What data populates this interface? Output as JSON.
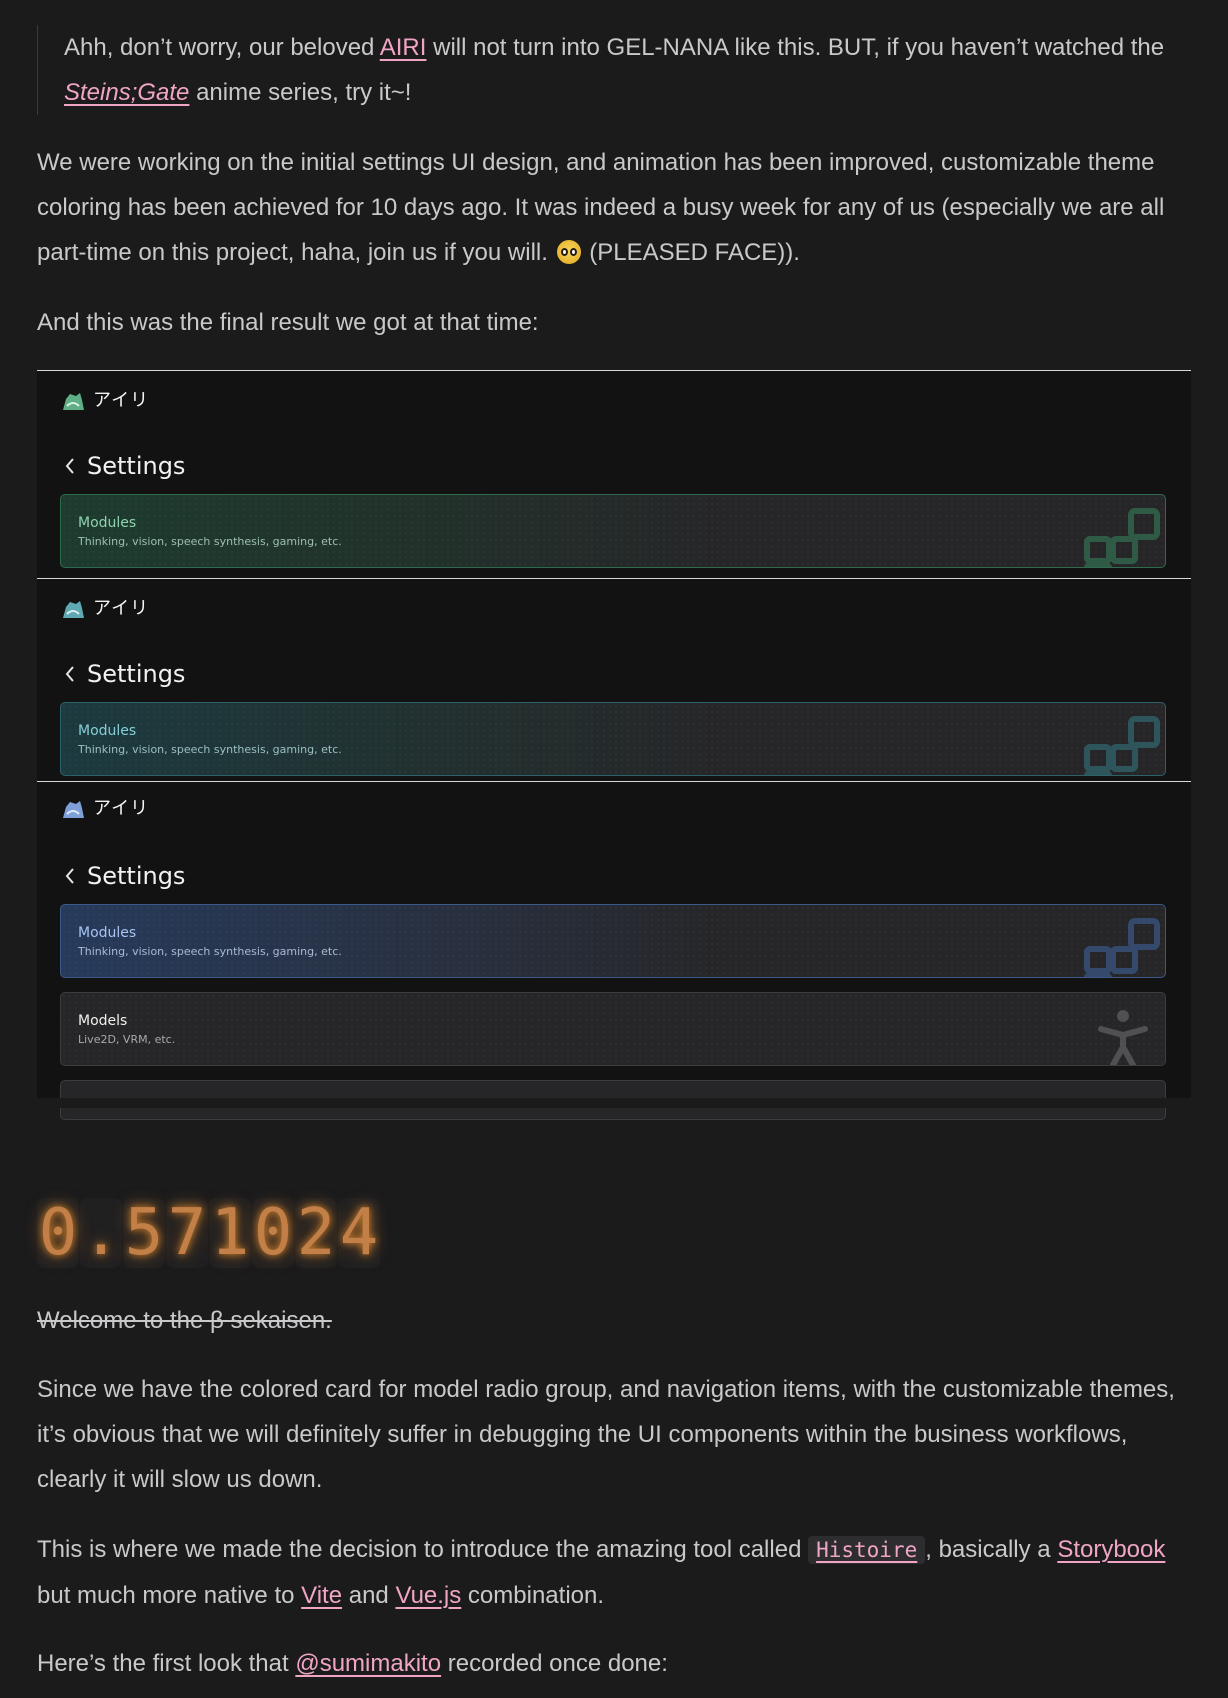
{
  "quote": {
    "pre": "Ahh, don’t worry, our beloved ",
    "airi_link": "AIRI",
    "mid": " will not turn into GEL-NANA like this. BUT, if you haven’t watched the ",
    "steins_link": "Steins;Gate",
    "post": " anime series, try it~!"
  },
  "para1": {
    "text": "We were working on the initial settings UI design, and animation has been improved, customizable theme coloring has been achieved for 10 days ago. It was indeed a busy week for any of us (especially we are all part-time on this project, haha, join us if you will. ",
    "emoji": "pleading-face-emoji",
    "tail": " (PLEASED FACE))."
  },
  "para2": "And this was the final result we got at that time:",
  "screenshots": [
    {
      "brand": "アイリ",
      "settings_title": "Settings",
      "accent": "#6fb894",
      "card": {
        "title": "Modules",
        "subtitle": "Thinking, vision, speech synthesis, gaming, etc."
      }
    },
    {
      "brand": "アイリ",
      "settings_title": "Settings",
      "accent": "#6cb6c0",
      "card": {
        "title": "Modules",
        "subtitle": "Thinking, vision, speech synthesis, gaming, etc."
      }
    },
    {
      "brand": "アイリ",
      "settings_title": "Settings",
      "accent": "#8aaee8",
      "card": {
        "title": "Modules",
        "subtitle": "Thinking, vision, speech synthesis, gaming, etc."
      },
      "card2": {
        "title": "Models",
        "subtitle": "Live2D, VRM, etc."
      }
    }
  ],
  "counter": [
    "0",
    ".",
    "5",
    "7",
    "1",
    "0",
    "2",
    "4"
  ],
  "strike": "Welcome to the β sekaisen.",
  "para3": "Since we have the colored card for model radio group, and navigation items, with the customizable themes, it’s obvious that we will definitely suffer in debugging the UI components within the business workflows, clearly it will slow us down.",
  "para4": {
    "pre": "This is where we made the decision to introduce the amazing tool called ",
    "code_link": "Histoire",
    "mid1": ", basically a ",
    "storybook_link": "Storybook",
    "mid2": " but much more native to ",
    "vite_link": "Vite",
    "mid3": " and ",
    "vue_link": "Vue.js",
    "post": " combination."
  },
  "para5": {
    "pre": "Here’s the first look that ",
    "user_link": "@sumimakito",
    "post": " recorded once done:"
  }
}
